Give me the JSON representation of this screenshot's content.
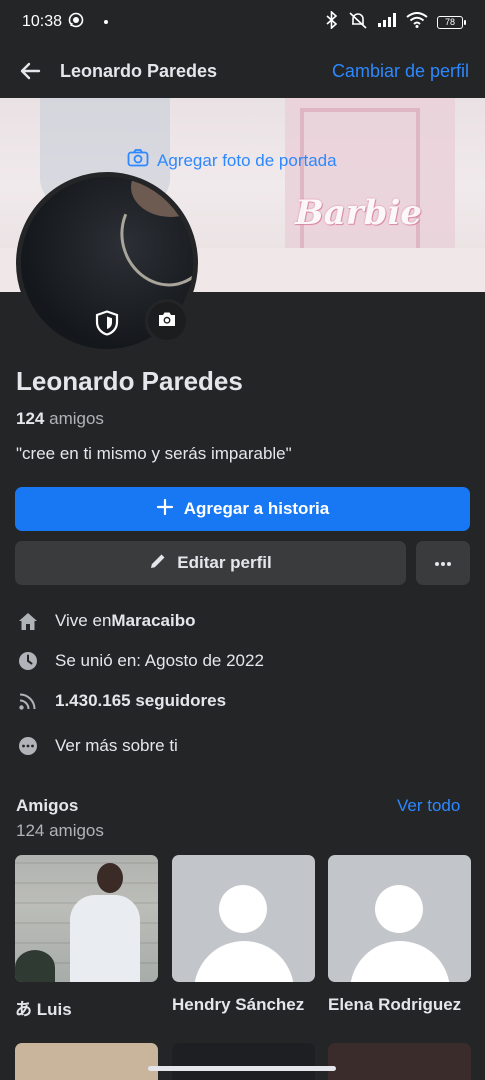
{
  "status_bar": {
    "time": "10:38",
    "battery": "78",
    "icons": [
      "whatsapp-icon",
      "bluetooth-icon",
      "mute-icon",
      "signal-icon",
      "wifi-icon",
      "battery-icon"
    ]
  },
  "header": {
    "title": "Leonardo Paredes",
    "switch_profile": "Cambiar de perfil"
  },
  "cover": {
    "add_cover_label": "Agregar foto de portada",
    "cover_text": "Barbie"
  },
  "profile": {
    "name": "Leonardo Paredes",
    "friends_count": "124",
    "friends_word": "amigos",
    "bio": "\"cree en ti mismo y serás imparable\""
  },
  "actions": {
    "add_story": "Agregar a historia",
    "edit_profile": "Editar perfil"
  },
  "details": {
    "lives_prefix": "Vive en ",
    "lives_city": "Maracaibo",
    "joined": "Se unió en: Agosto de 2022",
    "followers": "1.430.165 seguidores",
    "see_more": "Ver más sobre ti"
  },
  "friends": {
    "title": "Amigos",
    "subtitle": "124 amigos",
    "see_all": "Ver todo",
    "items": [
      {
        "name": "あ Luis"
      },
      {
        "name": "Hendry Sánchez"
      },
      {
        "name": "Elena Rodriguez"
      }
    ]
  },
  "colors": {
    "background": "#242526",
    "accent": "#1877f2",
    "link": "#2d88ff",
    "button_secondary": "#3a3b3c"
  }
}
